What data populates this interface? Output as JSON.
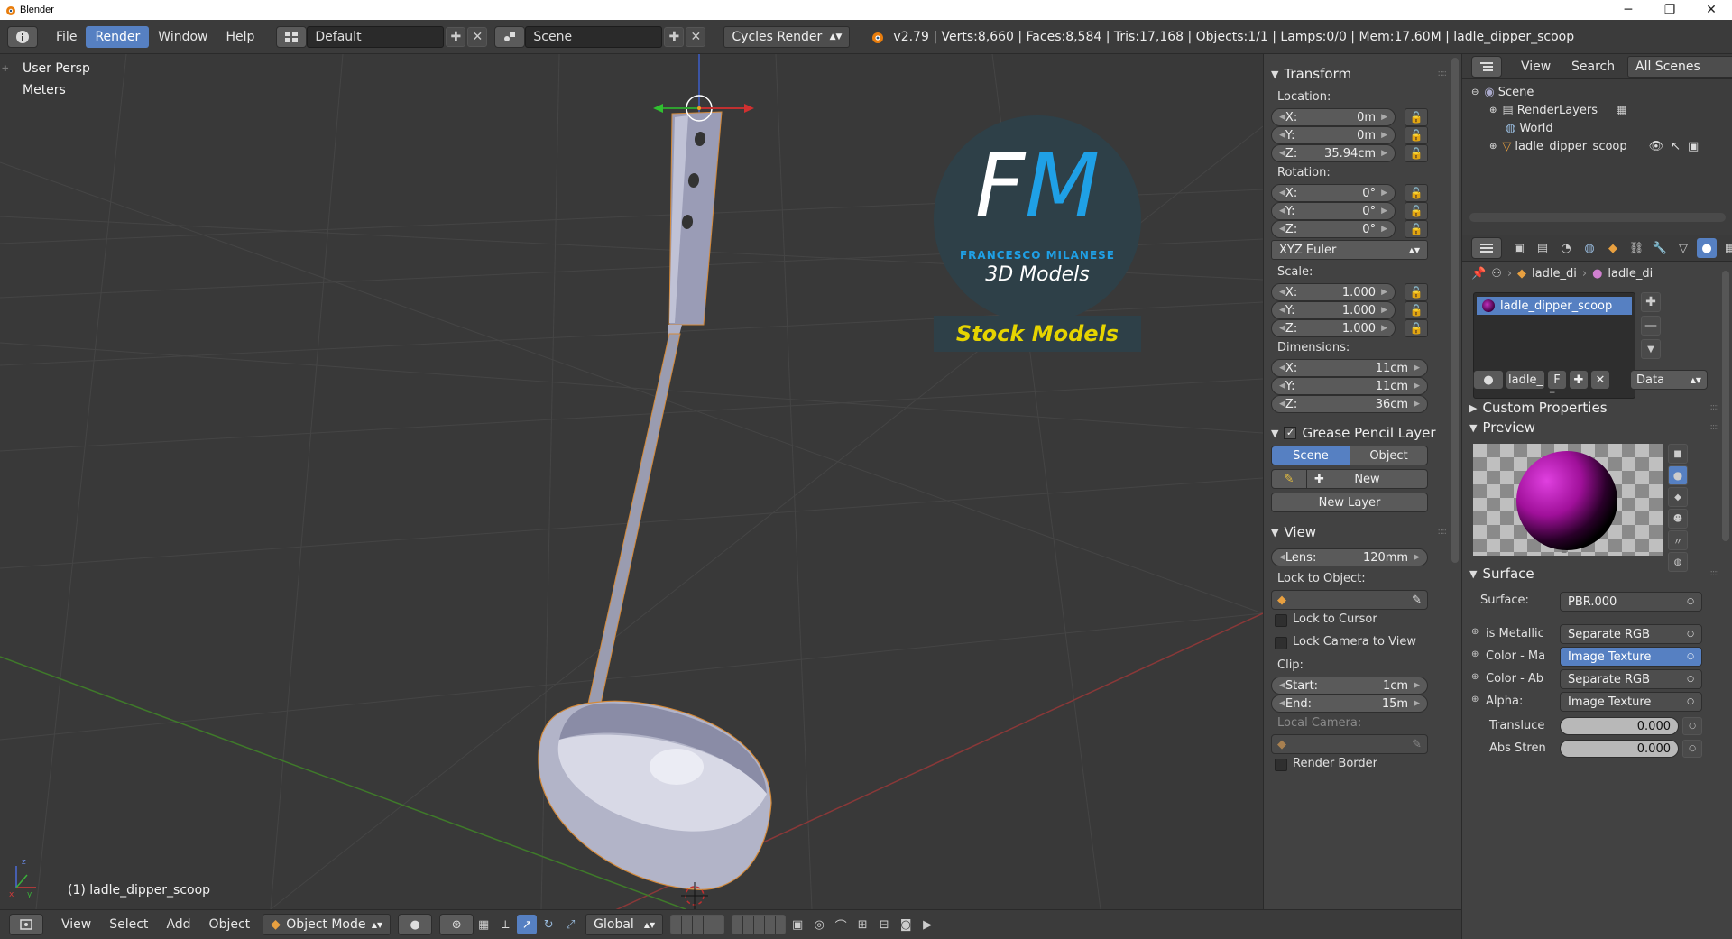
{
  "window": {
    "title": "Blender",
    "minimize": "─",
    "maximize": "❐",
    "close": "✕"
  },
  "infobar": {
    "menus": [
      "File",
      "Render",
      "Window",
      "Help"
    ],
    "active_menu": "Render",
    "screen_layout": "Default",
    "scene": "Scene",
    "render_engine": "Cycles Render",
    "stats": "v2.79 | Verts:8,660 | Faces:8,584 | Tris:17,168 | Objects:1/1 | Lamps:0/0 | Mem:17.60M | ladle_dipper_scoop"
  },
  "viewport": {
    "view_name": "User Persp",
    "units": "Meters",
    "object_label": "(1) ladle_dipper_scoop",
    "watermark": {
      "initials": "FM",
      "company": "FRANCESCO MILANESE",
      "subtitle": "3D Models",
      "banner": "Stock Models"
    }
  },
  "npanel": {
    "transform": {
      "header": "Transform",
      "location_label": "Location:",
      "location": [
        {
          "axis": "X:",
          "value": "0m"
        },
        {
          "axis": "Y:",
          "value": "0m"
        },
        {
          "axis": "Z:",
          "value": "35.94cm"
        }
      ],
      "rotation_label": "Rotation:",
      "rotation": [
        {
          "axis": "X:",
          "value": "0°"
        },
        {
          "axis": "Y:",
          "value": "0°"
        },
        {
          "axis": "Z:",
          "value": "0°"
        }
      ],
      "rotation_mode": "XYZ Euler",
      "scale_label": "Scale:",
      "scale": [
        {
          "axis": "X:",
          "value": "1.000"
        },
        {
          "axis": "Y:",
          "value": "1.000"
        },
        {
          "axis": "Z:",
          "value": "1.000"
        }
      ],
      "dimensions_label": "Dimensions:",
      "dimensions": [
        {
          "axis": "X:",
          "value": "11cm"
        },
        {
          "axis": "Y:",
          "value": "11cm"
        },
        {
          "axis": "Z:",
          "value": "36cm"
        }
      ]
    },
    "grease_pencil": {
      "header": "Grease Pencil Layer",
      "tab_scene": "Scene",
      "tab_object": "Object",
      "new_label": "New",
      "new_layer_label": "New Layer"
    },
    "view": {
      "header": "View",
      "lens_label": "Lens:",
      "lens_value": "120mm",
      "lock_to_object_label": "Lock to Object:",
      "lock_to_cursor": "Lock to Cursor",
      "lock_camera_to_view": "Lock Camera to View",
      "clip_label": "Clip:",
      "clip_start_label": "Start:",
      "clip_start": "1cm",
      "clip_end_label": "End:",
      "clip_end": "15m",
      "local_camera_label": "Local Camera:",
      "render_border": "Render Border"
    }
  },
  "outliner": {
    "menu_view": "View",
    "menu_search": "Search",
    "filter": "All Scenes",
    "rows": [
      {
        "label": "Scene"
      },
      {
        "label": "RenderLayers"
      },
      {
        "label": "World"
      },
      {
        "label": "ladle_dipper_scoop"
      }
    ]
  },
  "properties": {
    "breadcrumb": [
      "ladle_di",
      "ladle_di"
    ],
    "material_slot": "ladle_dipper_scoop",
    "material_name": "ladle_",
    "fake_user": "F",
    "link_mode": "Data",
    "custom_properties": "Custom Properties",
    "preview": "Preview",
    "surface_header": "Surface",
    "surface_label": "Surface:",
    "surface_value": "PBR.000",
    "inputs": [
      {
        "label": "is Metallic",
        "value": "Separate RGB"
      },
      {
        "label": "Color - Ma",
        "value": "Image Texture"
      },
      {
        "label": "Color - Ab",
        "value": "Separate RGB"
      },
      {
        "label": "Alpha:",
        "value": "Image Texture"
      }
    ],
    "translucence_label": "Transluce",
    "translucence_value": "0.000",
    "abs_strength_label": "Abs Stren",
    "abs_strength_value": "0.000"
  },
  "bottombar": {
    "menus": [
      "View",
      "Select",
      "Add",
      "Object"
    ],
    "mode": "Object Mode",
    "orientation": "Global"
  },
  "colors": {
    "accent": "#5680c2",
    "viewport_bg": "#393939",
    "panel_bg": "#424242",
    "material_color": "#a0109a",
    "banner_text": "#e6d400"
  }
}
